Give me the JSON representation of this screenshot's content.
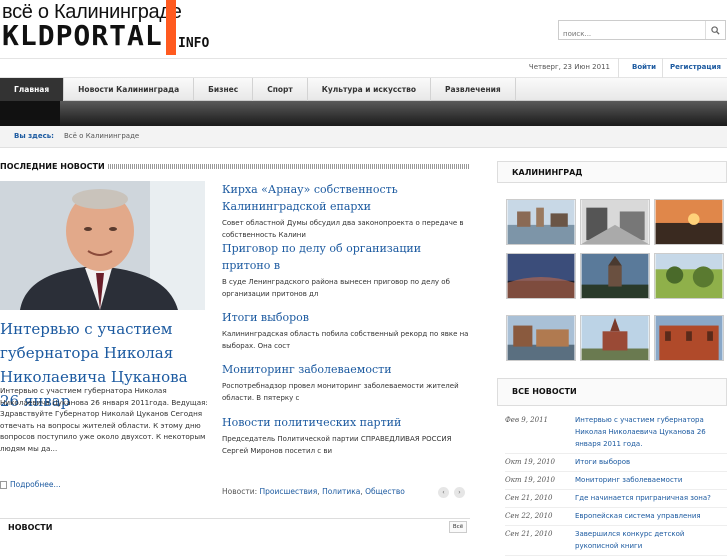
{
  "header": {
    "logo_top": "всё о Калининграде",
    "logo_main": "KLDPORTAL",
    "logo_suffix": "INFO",
    "search_placeholder": "поиск..."
  },
  "topbar": {
    "date": "Четверг, 23 Июн 2011",
    "login": "Войти",
    "register": "Регистрация"
  },
  "nav": {
    "items": [
      "Главная",
      "Новости Калининграда",
      "Бизнес",
      "Спорт",
      "Культура и искусство",
      "Развлечения"
    ]
  },
  "breadcrumb": {
    "label": "Вы здесь:",
    "current": "Всё о Калининграде"
  },
  "latest": {
    "title": "ПОСЛЕДНИЕ НОВОСТИ",
    "featured_title": "Интервью с участием губернатора Николая Николаевича Цуканова 26 январ",
    "featured_text": "Интервью с участием губернатора Николая Николаевича Цуканова 26 января 2011года. Ведущая: Здравствуйте Губернатор Николай Цуканов Сегодня отвечать на вопросы жителей области. К этому дню вопросов поступило уже около двухсот. К некоторым людям мы да...",
    "more": "Подробнее...",
    "items": [
      {
        "title": "Кирха «Арнау» собственность Калининградской епархи",
        "desc": "Совет областной Думы обсудил два законопроекта о передаче в собственность Калини"
      },
      {
        "title": "Приговор по делу об организации притоно в",
        "desc": "В суде Ленинградского района вынесен приговор по делу об организации притонов дл"
      },
      {
        "title": "Итоги выборов",
        "desc": "Калининградская область побила собственный рекорд по явке на выборах. Она сост"
      },
      {
        "title": "Мониторинг заболеваемости",
        "desc": "Роспотребнадзор провел мониторинг заболеваемости жителей области. В пятерку с"
      },
      {
        "title": "Новости политических партий",
        "desc": "Председатель Политической партии СПРАВЕДЛИВАЯ РОССИЯ Сергей Миронов посетил с ви"
      }
    ],
    "categories_label": "Новости:",
    "categories": [
      "Происшествия",
      "Политика",
      "Общество"
    ],
    "prev": "‹",
    "next": "›"
  },
  "news_section": {
    "title": "НОВОСТИ",
    "all_button": "Всё"
  },
  "sidebar": {
    "gallery_title": "КАЛИНИНГРАД",
    "all_news_title": "ВСЕ НОВОСТИ",
    "all_news": [
      {
        "date": "Фев 9, 2011",
        "title": "Интервью с участием губернатора Николая Николаевича Цуканова 26 января 2011 года."
      },
      {
        "date": "Окт 19, 2010",
        "title": "Итоги выборов"
      },
      {
        "date": "Окт 19, 2010",
        "title": "Мониторинг заболеваемости"
      },
      {
        "date": "Сен 21, 2010",
        "title": "Где начинается приграничная зона?"
      },
      {
        "date": "Сен 22, 2010",
        "title": "Европейская система управления"
      },
      {
        "date": "Сен 21, 2010",
        "title": "Завершился конкурс детской рукописной книги"
      }
    ]
  },
  "colors": {
    "accent": "#1c5aa0",
    "logo_bar": "#ff5a1f",
    "nav_active": "#333333"
  }
}
